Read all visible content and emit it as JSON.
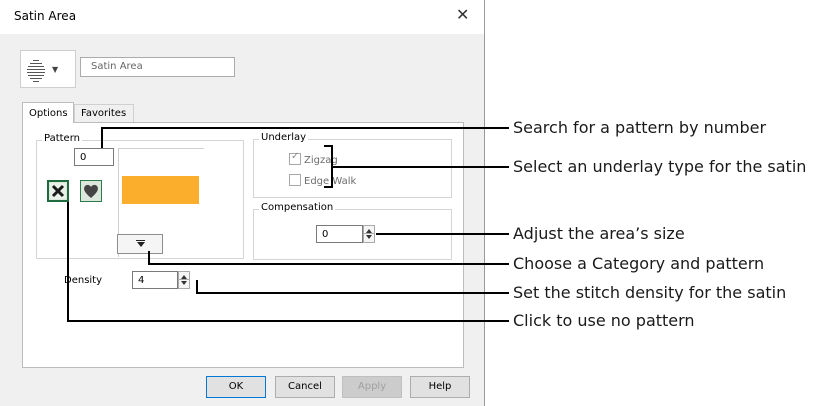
{
  "window": {
    "title": "Satin Area",
    "close_glyph": "✕"
  },
  "header": {
    "type_icon": "satin-stripes-icon",
    "name_value": "Satin Area"
  },
  "tabs": [
    {
      "label": "Options"
    },
    {
      "label": "Favorites"
    }
  ],
  "pattern": {
    "label": "Pattern",
    "number_value": "0",
    "swatch_color": "#fbae2c",
    "no_pattern_icon": "no-pattern-x-icon",
    "heart_icon": "heart-icon",
    "category_icon": "chevron-down-icon"
  },
  "underlay": {
    "label": "Underlay",
    "zigzag": {
      "label": "Zigzag",
      "checked": true
    },
    "edge_walk": {
      "label": "Edge Walk",
      "checked": false
    }
  },
  "compensation": {
    "label": "Compensation",
    "value": "0"
  },
  "density": {
    "label": "Density",
    "value": "4"
  },
  "buttons": {
    "ok": "OK",
    "cancel": "Cancel",
    "apply": "Apply",
    "help": "Help"
  },
  "callouts": [
    "Search for a pattern by number",
    "Select an underlay type for the satin",
    "Adjust the area’s size",
    "Choose a Category and pattern",
    "Set the stitch density for the satin",
    "Click to use no pattern"
  ]
}
